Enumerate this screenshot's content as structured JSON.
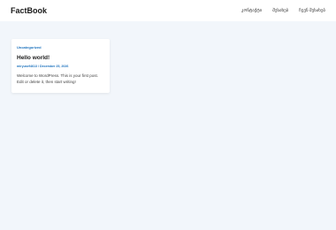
{
  "header": {
    "site_title": "FactBook",
    "nav": [
      {
        "label": "კონტაქტი"
      },
      {
        "label": "შესახებ"
      },
      {
        "label": "ჩვენ შესახებ"
      }
    ]
  },
  "post": {
    "category": "Uncategorized",
    "title": "Hello world!",
    "author": "miryusef4613",
    "separator": " / ",
    "date": "December 25, 2026",
    "excerpt": "Welcome to WordPress. This is your first post. Edit or delete it, then start writing!"
  },
  "colors": {
    "accent": "#1e73be",
    "background": "#f2f6fb"
  }
}
